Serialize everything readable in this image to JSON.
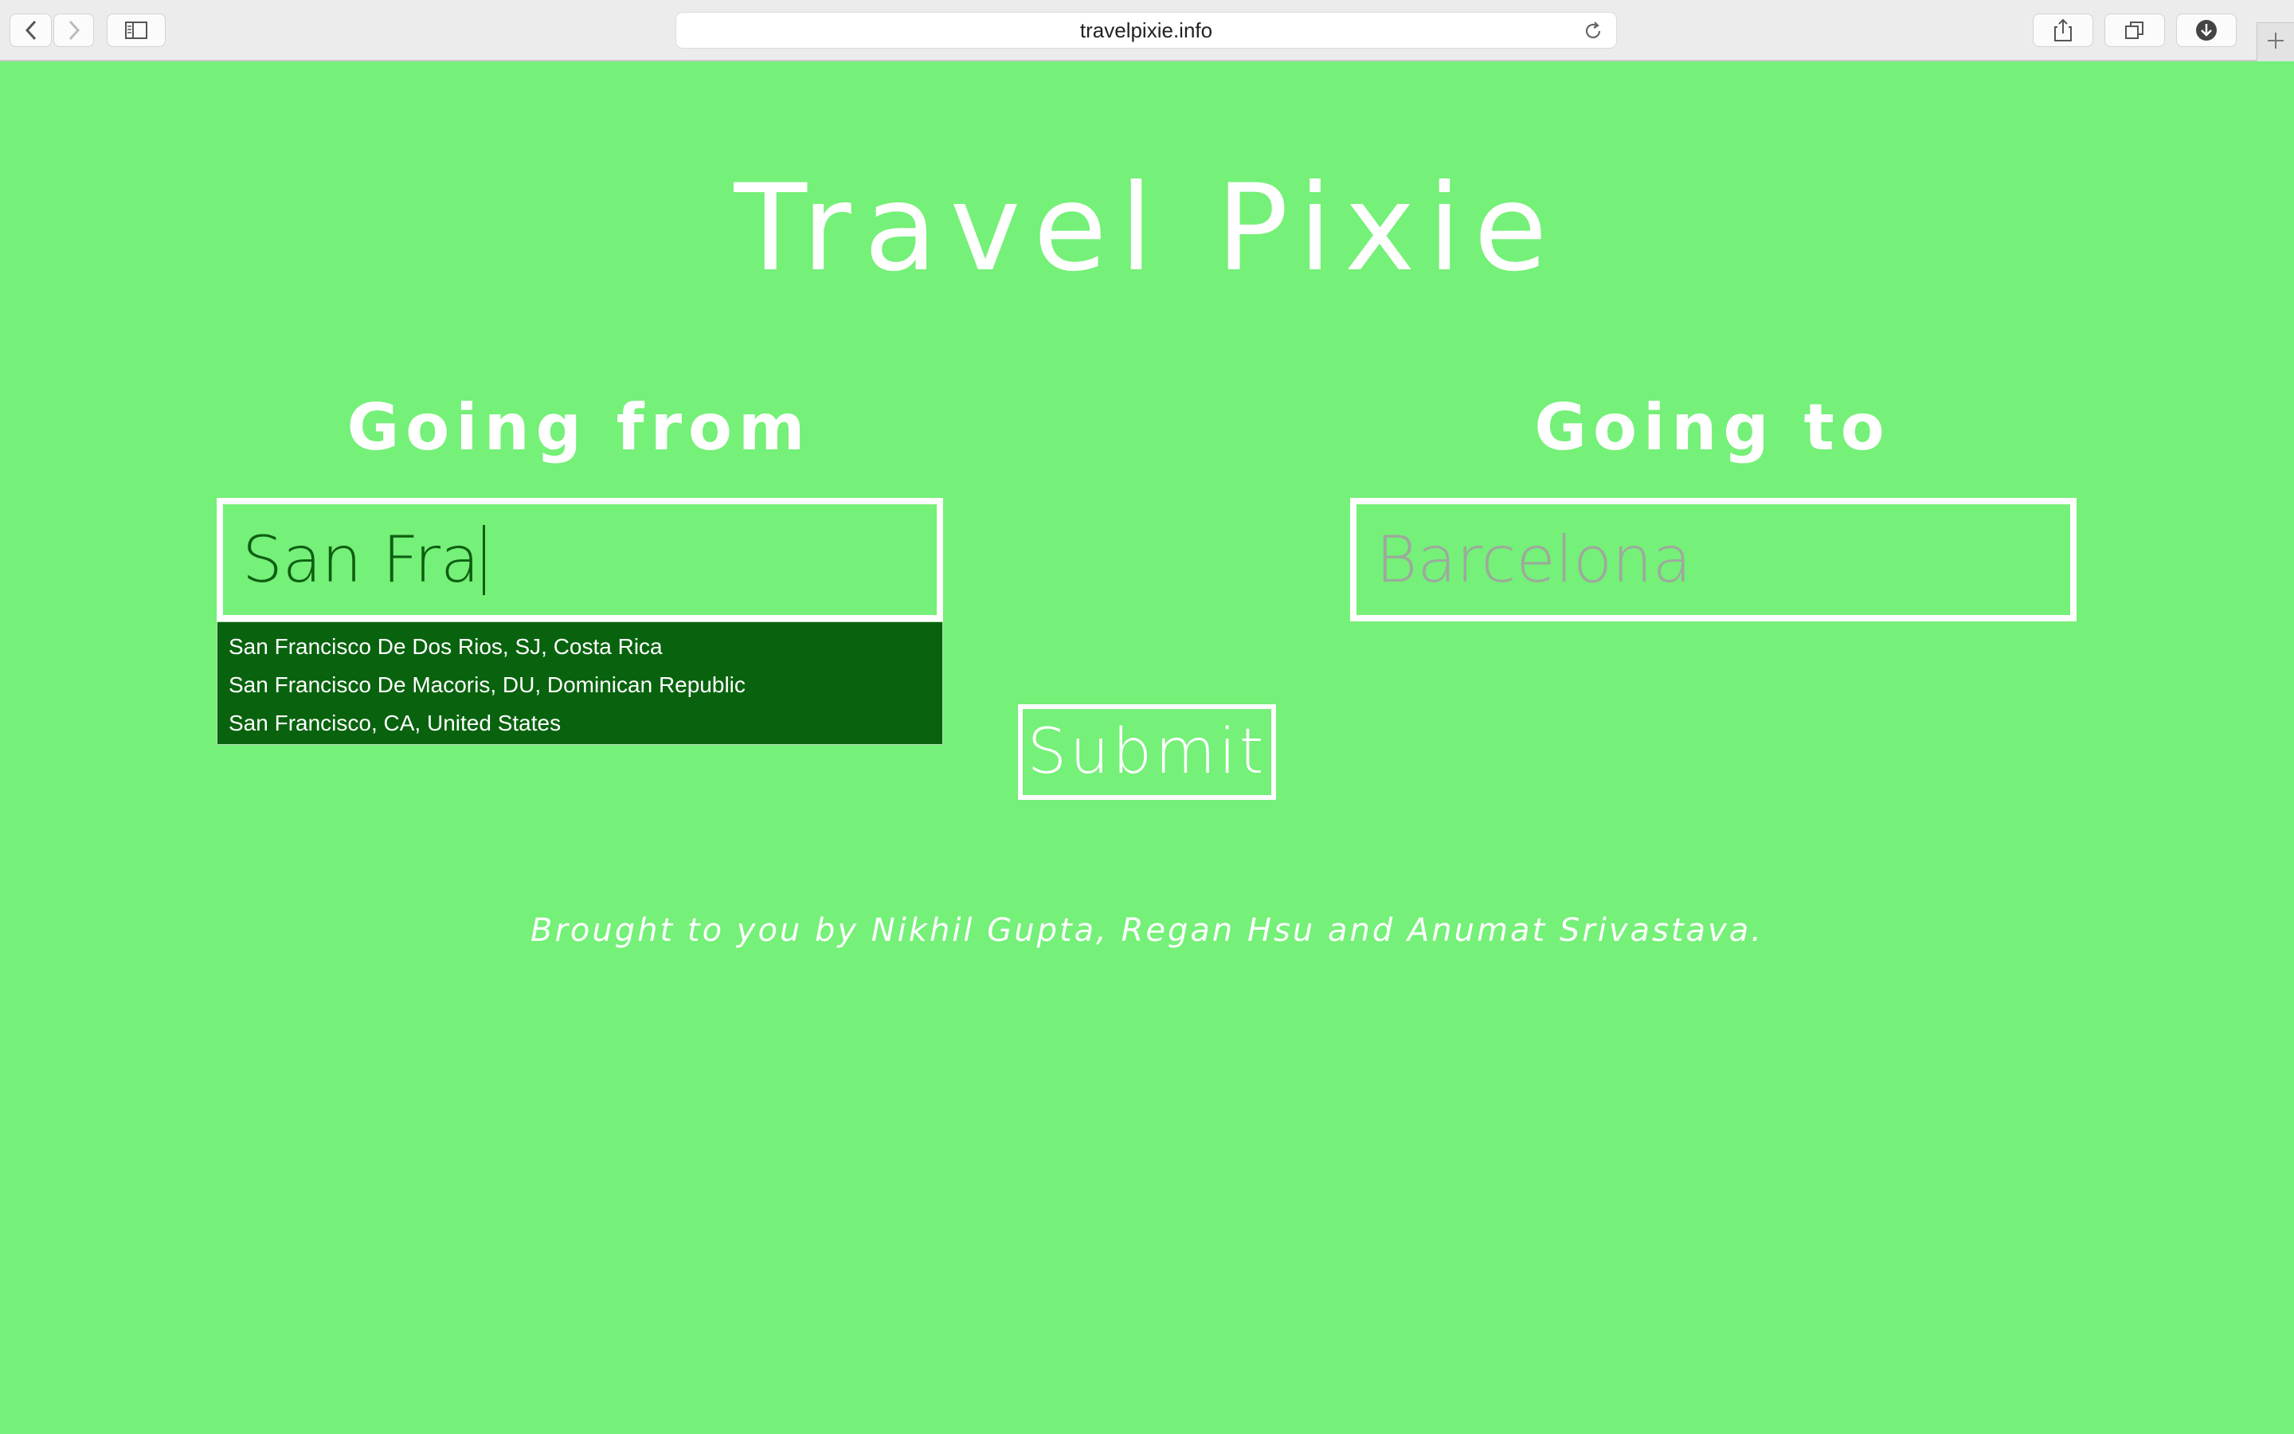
{
  "browser": {
    "url": "travelpixie.info",
    "icons": {
      "back": "chevron-left-icon",
      "forward": "chevron-right-icon",
      "sidebar": "sidebar-icon",
      "reload": "reload-icon",
      "share": "share-icon",
      "tabs": "tabs-icon",
      "downloads": "download-icon",
      "new_tab": "plus-icon"
    }
  },
  "page": {
    "title": "Travel Pixie",
    "from": {
      "heading": "Going from",
      "value": "San Fra",
      "suggestions": [
        "San Francisco De Dos Rios, SJ, Costa Rica",
        "San Francisco De Macoris, DU, Dominican Republic",
        "San Francisco, CA, United States"
      ]
    },
    "to": {
      "heading": "Going to",
      "placeholder": "Barcelona"
    },
    "submit_label": "Submit",
    "credits": "Brought to you by Nikhil Gupta, Regan Hsu and Anumat Srivastava."
  },
  "colors": {
    "background": "#75f078",
    "dropdown": "#09630e",
    "text": "#ffffff",
    "input_text": "#0d5f12"
  }
}
